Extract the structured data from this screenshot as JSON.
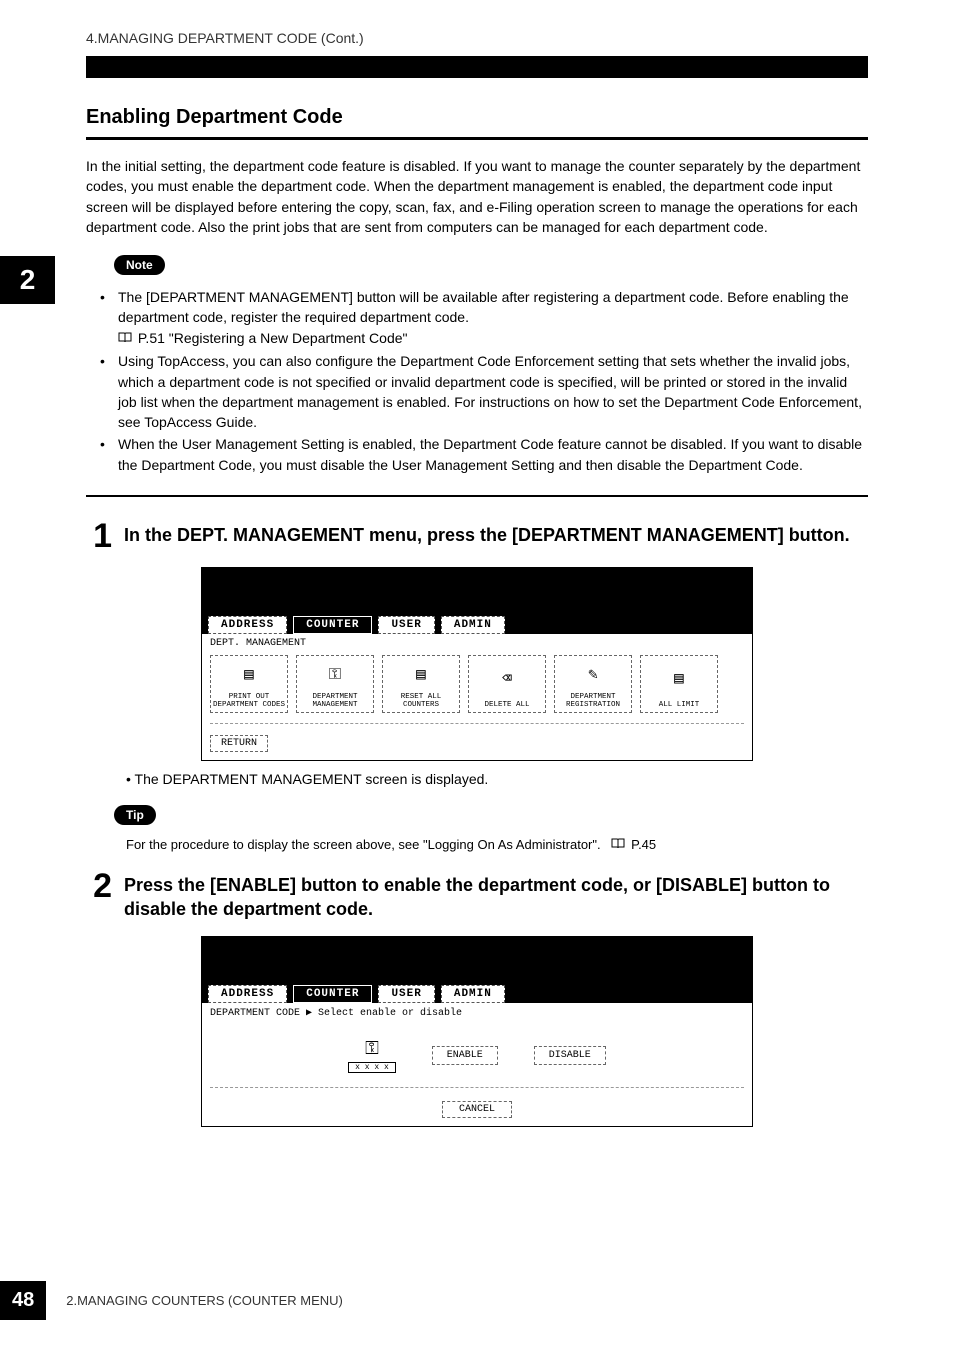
{
  "header": "4.MANAGING DEPARTMENT CODE (Cont.)",
  "side_tab": "2",
  "section_title": "Enabling Department Code",
  "intro": "In the initial setting, the department code feature is disabled.  If you want to manage the counter separately by the department codes, you must enable the department code.  When the department management is enabled, the department code input screen will be displayed before entering the copy, scan, fax, and e-Filing operation screen to manage the operations for each department code.  Also the print jobs that are sent from computers can be managed for each department code.",
  "note_label": "Note",
  "notes": [
    {
      "text": "The [DEPARTMENT MANAGEMENT] button will be available after registering a department code. Before enabling the department code, register the required department code.",
      "ref": "P.51 \"Registering a New Department Code\""
    },
    {
      "text": "Using TopAccess, you can also configure the Department Code Enforcement setting that sets whether the invalid jobs, which a department code is not specified or invalid department code is specified, will be printed or stored in the invalid job list when the department management is enabled. For instructions on how to set the Department Code Enforcement, see TopAccess Guide."
    },
    {
      "text": "When the User Management Setting is enabled, the Department Code feature cannot be disabled. If you want to disable the Department Code, you must disable the User Management Setting and then disable the Department Code."
    }
  ],
  "steps": {
    "s1_num": "1",
    "s1_text": "In the DEPT. MANAGEMENT menu, press the [DEPARTMENT MANAGEMENT] button.",
    "s1_after": "The DEPARTMENT MANAGEMENT screen is displayed.",
    "s2_num": "2",
    "s2_text": "Press the [ENABLE] button to enable the department code, or [DISABLE] button to disable the department code."
  },
  "tip_label": "Tip",
  "tip_text": "For the procedure to display the screen above, see \"Logging On As Administrator\".",
  "tip_ref": "P.45",
  "screen1": {
    "tabs": [
      "ADDRESS",
      "COUNTER",
      "USER",
      "ADMIN"
    ],
    "active_tab": 1,
    "subtitle": "DEPT. MANAGEMENT",
    "buttons": [
      "PRINT OUT DEPARTMENT CODES",
      "DEPARTMENT MANAGEMENT",
      "RESET ALL COUNTERS",
      "DELETE ALL",
      "DEPARTMENT REGISTRATION",
      "ALL LIMIT"
    ],
    "return": "RETURN"
  },
  "screen2": {
    "tabs": [
      "ADDRESS",
      "COUNTER",
      "USER",
      "ADMIN"
    ],
    "active_tab": 1,
    "subtitle": "DEPARTMENT CODE  ▶ Select enable or disable",
    "enable": "ENABLE",
    "disable": "DISABLE",
    "cancel": "CANCEL"
  },
  "footer": {
    "page": "48",
    "text": "2.MANAGING COUNTERS (COUNTER MENU)"
  }
}
